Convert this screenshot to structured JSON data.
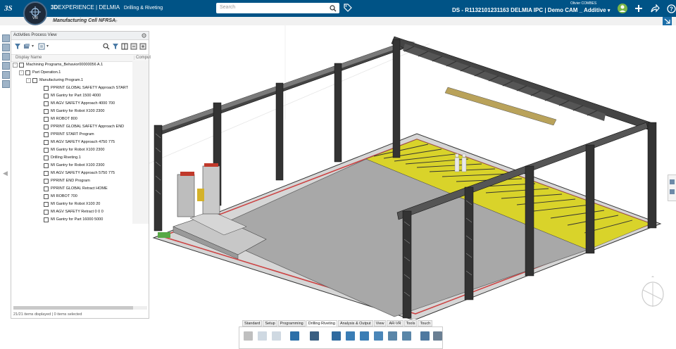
{
  "topbar": {
    "brand_bold": "3D",
    "brand_rest": "EXPERIENCE | DELMIA",
    "app_name": "Drilling & Riveting",
    "compass_version": "V.R",
    "search_placeholder": "Search",
    "context": "DS - R1132101231163 DELMIA IPC | Demo CAM _ Additive",
    "user": "Olivier COMBES",
    "colors": {
      "bar": "#005386",
      "accent": "#1b6ea8"
    }
  },
  "tabs": [
    {
      "label": "Manufacturing Cell NFRSA"
    }
  ],
  "panel": {
    "title": "Activities Process View",
    "col_display": "Display Name",
    "col_comp": "Comput",
    "status": "21/21 items displayed | 0 items selected",
    "tree": [
      {
        "label": "Machining Programs_Behavior00000056 A.1",
        "depth": 0,
        "icon": "machining-program-icon"
      },
      {
        "label": "Part Operation.1",
        "depth": 1,
        "icon": "part-operation-icon"
      },
      {
        "label": "Manufacturing Program.1",
        "depth": 2,
        "icon": "manufacturing-program-icon"
      },
      {
        "label": "PPRINT GLOBAL SAFETY Approach START",
        "depth": 3,
        "icon": "pprint-icon"
      },
      {
        "label": "MI Gantry for Part 1500 4000",
        "depth": 3,
        "icon": "move-icon"
      },
      {
        "label": "MI AGV SAFETY Approach 4000 700",
        "depth": 3,
        "icon": "move-icon"
      },
      {
        "label": "MI Gantry for Robot X100 2300",
        "depth": 3,
        "icon": "move-icon"
      },
      {
        "label": "MI ROBOT 800",
        "depth": 3,
        "icon": "move-icon"
      },
      {
        "label": "PPRINT GLOBAL SAFETY Approach END",
        "depth": 3,
        "icon": "pprint-icon"
      },
      {
        "label": "PPRINT START Program",
        "depth": 3,
        "icon": "pprint-icon"
      },
      {
        "label": "MI AGV SAFETY Approach 4750 775",
        "depth": 3,
        "icon": "move-icon"
      },
      {
        "label": "MI Gantry for Robot X100 2300",
        "depth": 3,
        "icon": "move-icon"
      },
      {
        "label": "Drilling Riveting.1",
        "depth": 3,
        "icon": "drilling-icon"
      },
      {
        "label": "MI Gantry for Robot X100 2300",
        "depth": 3,
        "icon": "move-icon"
      },
      {
        "label": "MI AGV SAFETY Approach 5750 775",
        "depth": 3,
        "icon": "move-icon"
      },
      {
        "label": "PPRINT END Program",
        "depth": 3,
        "icon": "pprint-icon"
      },
      {
        "label": "PPRINT GLOBAL Retract HOME",
        "depth": 3,
        "icon": "pprint-icon"
      },
      {
        "label": "MI ROBOT 700",
        "depth": 3,
        "icon": "move-icon"
      },
      {
        "label": "MI Gantry for Robot X100 20",
        "depth": 3,
        "icon": "move-icon"
      },
      {
        "label": "MI AGV SAFETY Retract 0 0 0",
        "depth": 3,
        "icon": "move-icon"
      },
      {
        "label": "MI Gantry for Part 16000 5000",
        "depth": 3,
        "icon": "move-icon"
      }
    ]
  },
  "ribbon": {
    "tabs": [
      "Standard",
      "Setup",
      "Programming",
      "Drilling Riveting",
      "Analysis & Output",
      "View",
      "AR-VR",
      "Tools",
      "Touch"
    ],
    "active": "Drilling Riveting"
  }
}
